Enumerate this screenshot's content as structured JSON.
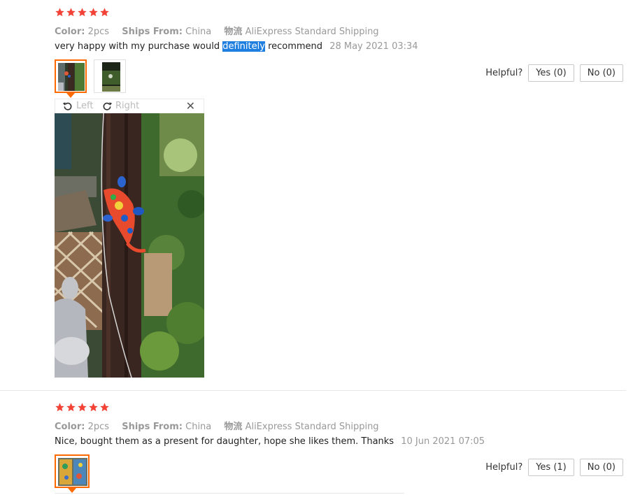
{
  "reviews": [
    {
      "rating": 5,
      "color_label": "Color:",
      "color_value": "2pcs",
      "ships_label": "Ships From:",
      "ships_value": "China",
      "logistics_label": "物流",
      "logistics_value": "AliExpress Standard Shipping",
      "text_before": "very happy with my purchase would ",
      "text_highlight": "definitely",
      "text_after": " recommend",
      "date": "28 May 2021 03:34",
      "helpful_label": "Helpful?",
      "yes_label": "Yes (0)",
      "no_label": "No (0)",
      "viewer": {
        "left_label": "Left",
        "right_label": "Right",
        "close_glyph": "✕"
      }
    },
    {
      "rating": 5,
      "color_label": "Color:",
      "color_value": "2pcs",
      "ships_label": "Ships From:",
      "ships_value": "China",
      "logistics_label": "物流",
      "logistics_value": "AliExpress Standard Shipping",
      "text": "Nice, bought them as a present for daughter, hope she likes them. Thanks",
      "date": "10 Jun 2021 07:05",
      "helpful_label": "Helpful?",
      "yes_label": "Yes (1)",
      "no_label": "No (0)"
    }
  ],
  "icons": {
    "star": "star-icon",
    "rotate_left": "rotate-left-icon",
    "rotate_right": "rotate-right-icon",
    "close": "close-icon"
  },
  "colors": {
    "star": "#f44336",
    "active_thumb": "#ff6a00",
    "highlight": "#1e7fe0",
    "muted_text": "#999999"
  }
}
